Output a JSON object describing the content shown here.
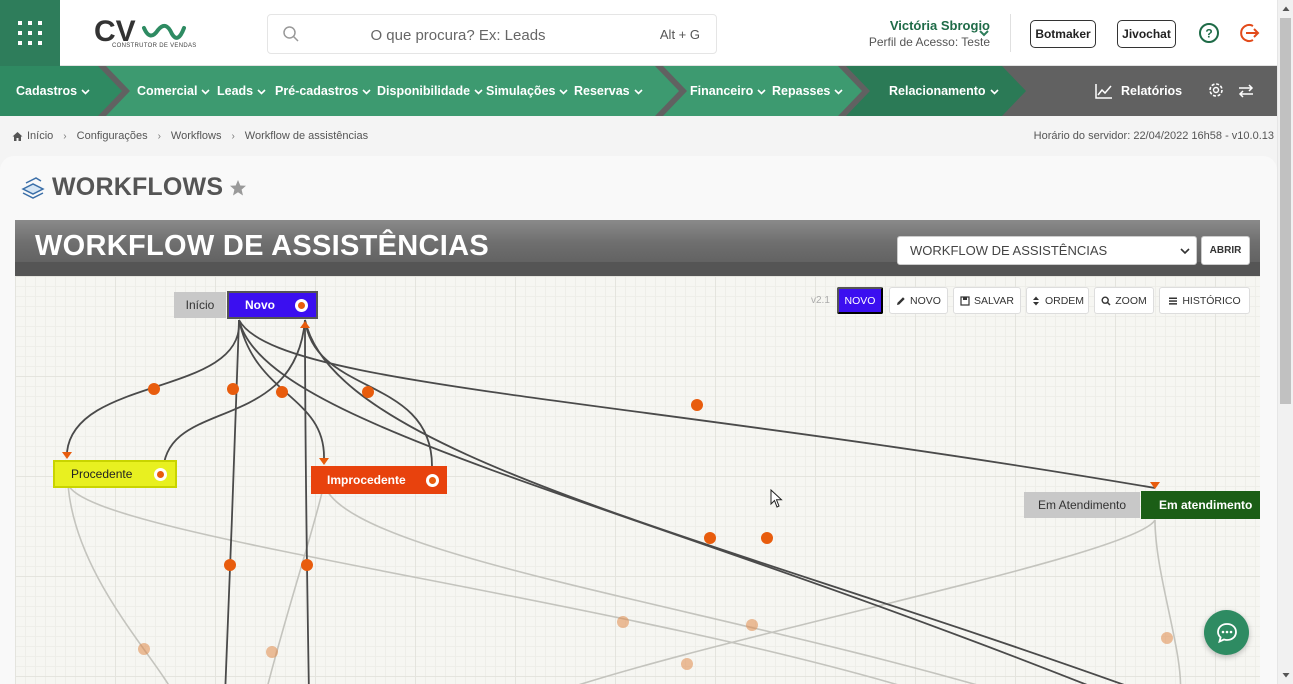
{
  "header": {
    "logo_text": "CV",
    "logo_subtitle": "CONSTRUTOR DE VENDAS",
    "search": {
      "placeholder": "O que procura? Ex: Leads",
      "shortcut": "Alt + G"
    },
    "user": {
      "name": "Victória Sbrogio",
      "profile": "Perfil de Acesso: Teste"
    },
    "buttons": {
      "botmaker": "Botmaker",
      "jivochat": "Jivochat"
    }
  },
  "nav": {
    "items": [
      {
        "label": "Cadastros"
      },
      {
        "label": "Comercial"
      },
      {
        "label": "Leads"
      },
      {
        "label": "Pré-cadastros"
      },
      {
        "label": "Disponibilidade"
      },
      {
        "label": "Simulações"
      },
      {
        "label": "Reservas"
      },
      {
        "label": "Financeiro"
      },
      {
        "label": "Repasses"
      },
      {
        "label": "Relacionamento"
      }
    ],
    "reports": "Relatórios"
  },
  "breadcrumb": {
    "items": [
      "Início",
      "Configurações",
      "Workflows",
      "Workflow de assistências"
    ],
    "server_time": "Horário do servidor: 22/04/2022 16h58 - v10.0.13"
  },
  "page": {
    "title": "WORKFLOWS"
  },
  "workflow": {
    "title": "WORKFLOW DE ASSISTÊNCIAS",
    "selected": "WORKFLOW DE ASSISTÊNCIAS",
    "open_button": "ABRIR",
    "version": "v2.1",
    "toolbar": {
      "novo_primary": "NOVO",
      "novo": "NOVO",
      "salvar": "SALVAR",
      "ordem": "ORDEM",
      "zoom": "ZOOM",
      "historico": "HISTÓRICO"
    },
    "nodes": {
      "inicio_label": "Início",
      "novo": "Novo",
      "procedente": "Procedente",
      "improcedente": "Improcedente",
      "em_atendimento_label": "Em Atendimento",
      "em_atendimento": "Em atendimento"
    },
    "colors": {
      "novo": "#3b0ff0",
      "procedente": "#e8f020",
      "improcedente": "#e8420d",
      "em_atendimento": "#1b5e16",
      "connector": "#e85c0d"
    }
  },
  "colors": {
    "brand": "#2e7d5b",
    "nav_green": "#3a8a66"
  }
}
